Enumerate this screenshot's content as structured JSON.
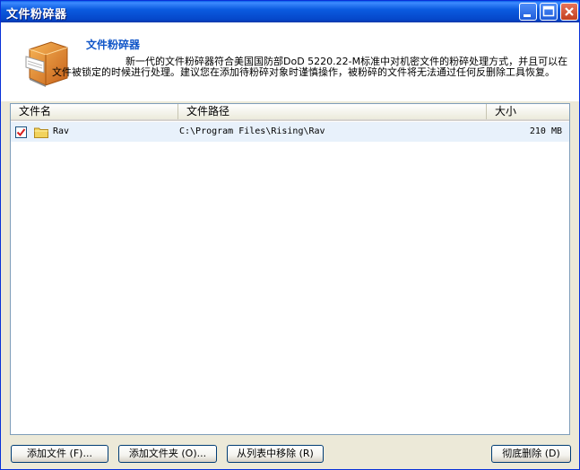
{
  "window": {
    "title": "文件粉碎器",
    "controls": [
      "minimize-icon",
      "maximize-icon",
      "close-icon"
    ]
  },
  "header": {
    "title": "文件粉碎器",
    "description": "新一代的文件粉碎器符合美国国防部DoD 5220.22-M标准中对机密文件的粉碎处理方式，并且可以在文件被锁定的时候进行处理。建议您在添加待粉碎对象时谨慎操作，被粉碎的文件将无法通过任何反删除工具恢复。",
    "icon": "shredder-icon"
  },
  "list": {
    "columns": [
      "文件名",
      "文件路径",
      "大小"
    ],
    "rows": [
      {
        "checked": true,
        "icon": "folder-icon",
        "name": "Rav",
        "path": "C:\\Program Files\\Rising\\Rav",
        "size": "210 MB"
      }
    ]
  },
  "buttons": {
    "add_file": "添加文件 (F)...",
    "add_folder": "添加文件夹 (O)...",
    "remove": "从列表中移除 (R)",
    "shred": "彻底删除 (D)"
  },
  "colors": {
    "titlebar": "#0A5FE6",
    "accent_title": "#1055C8",
    "row_selected": "#E8F1FB",
    "checkmark": "#D81E1E"
  }
}
